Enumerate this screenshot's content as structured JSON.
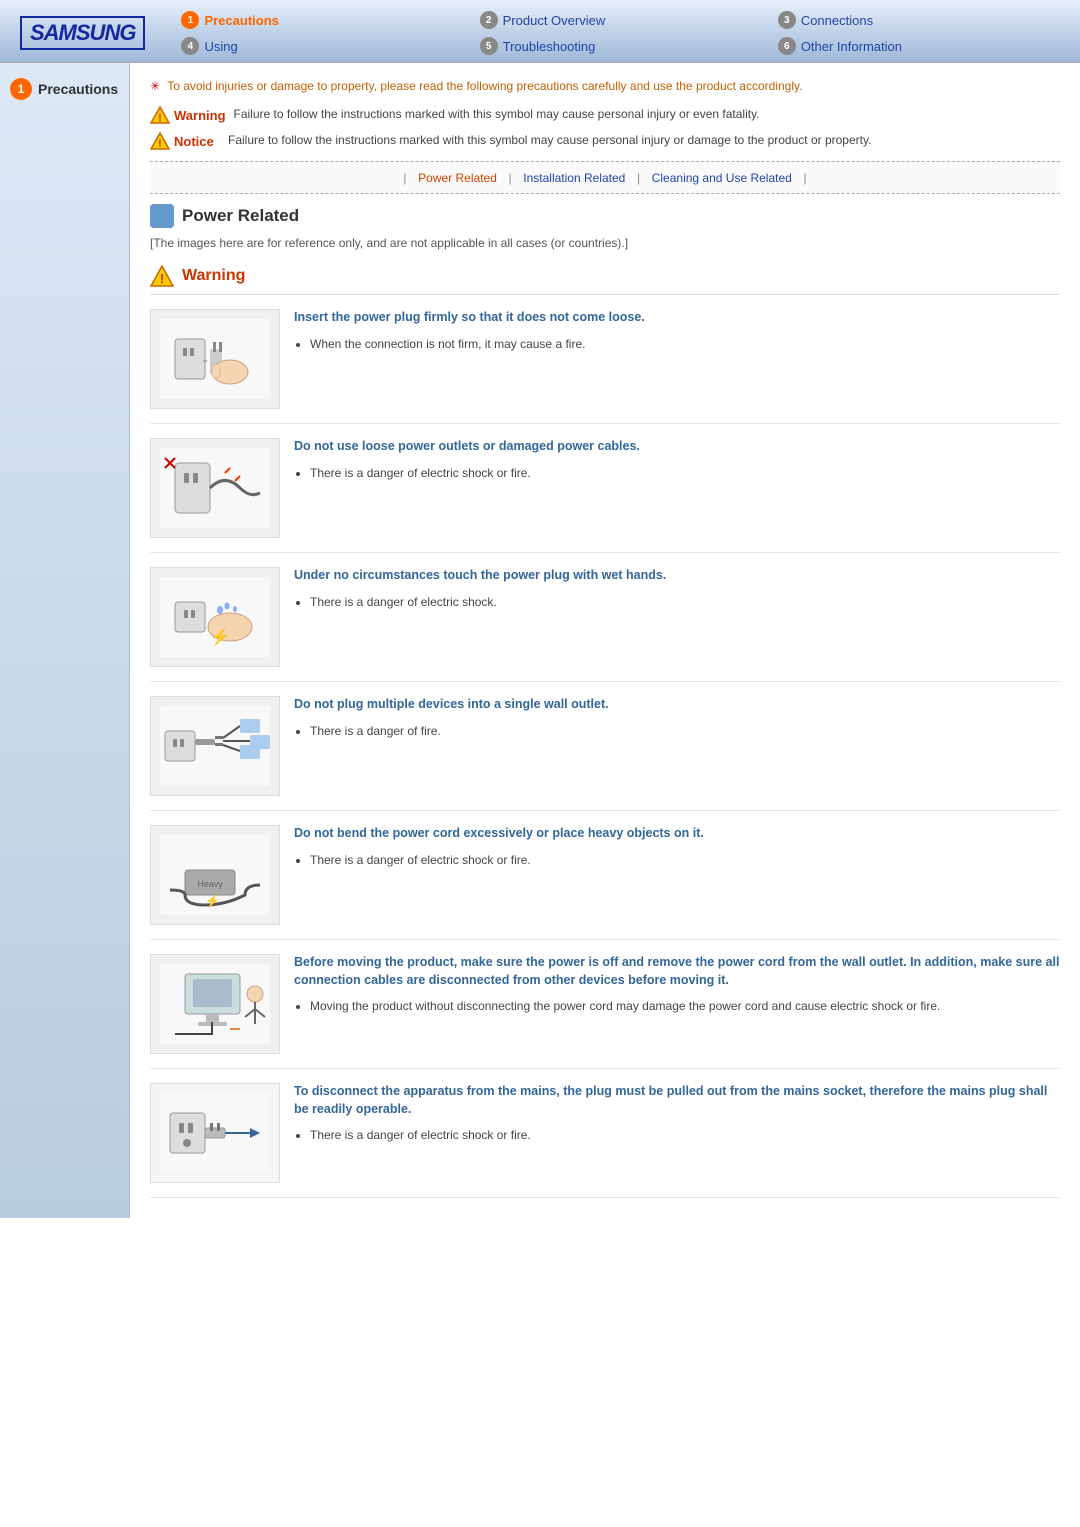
{
  "header": {
    "logo": "SAMSUNG",
    "nav": [
      {
        "num": "1",
        "label": "Precautions",
        "active": true,
        "style": "orange"
      },
      {
        "num": "2",
        "label": "Product Overview",
        "active": false,
        "style": "gray"
      },
      {
        "num": "3",
        "label": "Connections",
        "active": false,
        "style": "gray"
      },
      {
        "num": "4",
        "label": "Using",
        "active": false,
        "style": "gray"
      },
      {
        "num": "5",
        "label": "Troubleshooting",
        "active": false,
        "style": "gray"
      },
      {
        "num": "6",
        "label": "Other Information",
        "active": false,
        "style": "gray"
      }
    ]
  },
  "sidebar": {
    "num": "1",
    "label": "Precautions"
  },
  "notice": {
    "text": "To avoid injuries or damage to property, please read the following precautions carefully and use the product accordingly."
  },
  "warning_label": "Warning",
  "notice_label": "Notice",
  "warning_desc": "Failure to follow the instructions marked with this symbol may cause personal injury or even fatality.",
  "notice_desc": "Failure to follow the instructions marked with this symbol may cause personal injury or damage to the product or property.",
  "breadcrumb": {
    "items": [
      {
        "label": "Power Related",
        "active": true
      },
      {
        "label": "Installation Related",
        "active": false
      },
      {
        "label": "Cleaning and Use Related",
        "active": false
      }
    ]
  },
  "section": {
    "title": "Power Related",
    "note": "[The images here are for reference only, and are not applicable in all cases (or countries).]",
    "warning_header": "Warning",
    "items": [
      {
        "title": "Insert the power plug firmly so that it does not come loose.",
        "bullets": [
          "When the connection is not firm, it may cause a fire."
        ]
      },
      {
        "title": "Do not use loose power outlets or damaged power cables.",
        "bullets": [
          "There is a danger of electric shock or fire."
        ]
      },
      {
        "title": "Under no circumstances touch the power plug with wet hands.",
        "bullets": [
          "There is a danger of electric shock."
        ]
      },
      {
        "title": "Do not plug multiple devices into a single wall outlet.",
        "bullets": [
          "There is a danger of fire."
        ]
      },
      {
        "title": "Do not bend the power cord excessively or place heavy objects on it.",
        "bullets": [
          "There is a danger of electric shock or fire."
        ]
      },
      {
        "title": "Before moving the product, make sure the power is off and remove the power cord from the wall outlet. In addition, make sure all connection cables are disconnected from other devices before moving it.",
        "bullets": [
          "Moving the product without disconnecting the power cord may damage the power cord and cause electric shock or fire."
        ]
      },
      {
        "title": "To disconnect the apparatus from the mains, the plug must be pulled out from the mains socket, therefore the mains plug shall be readily operable.",
        "bullets": [
          "There is a danger of electric shock or fire."
        ]
      }
    ]
  }
}
